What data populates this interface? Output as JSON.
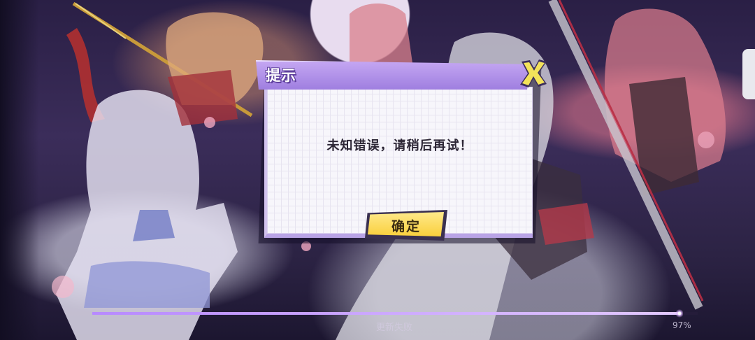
{
  "dialog": {
    "title": "提示",
    "message": "未知错误，请稍后再试！",
    "confirm_label": "确定"
  },
  "update": {
    "status": "更新失败",
    "percent_label": "97%",
    "progress": 0.97
  },
  "colors": {
    "header_purple": "#a98ae6",
    "button_yellow": "#f9cf3c",
    "close_yellow": "#f3e25a"
  },
  "icons": {
    "close": "close-x-icon"
  }
}
